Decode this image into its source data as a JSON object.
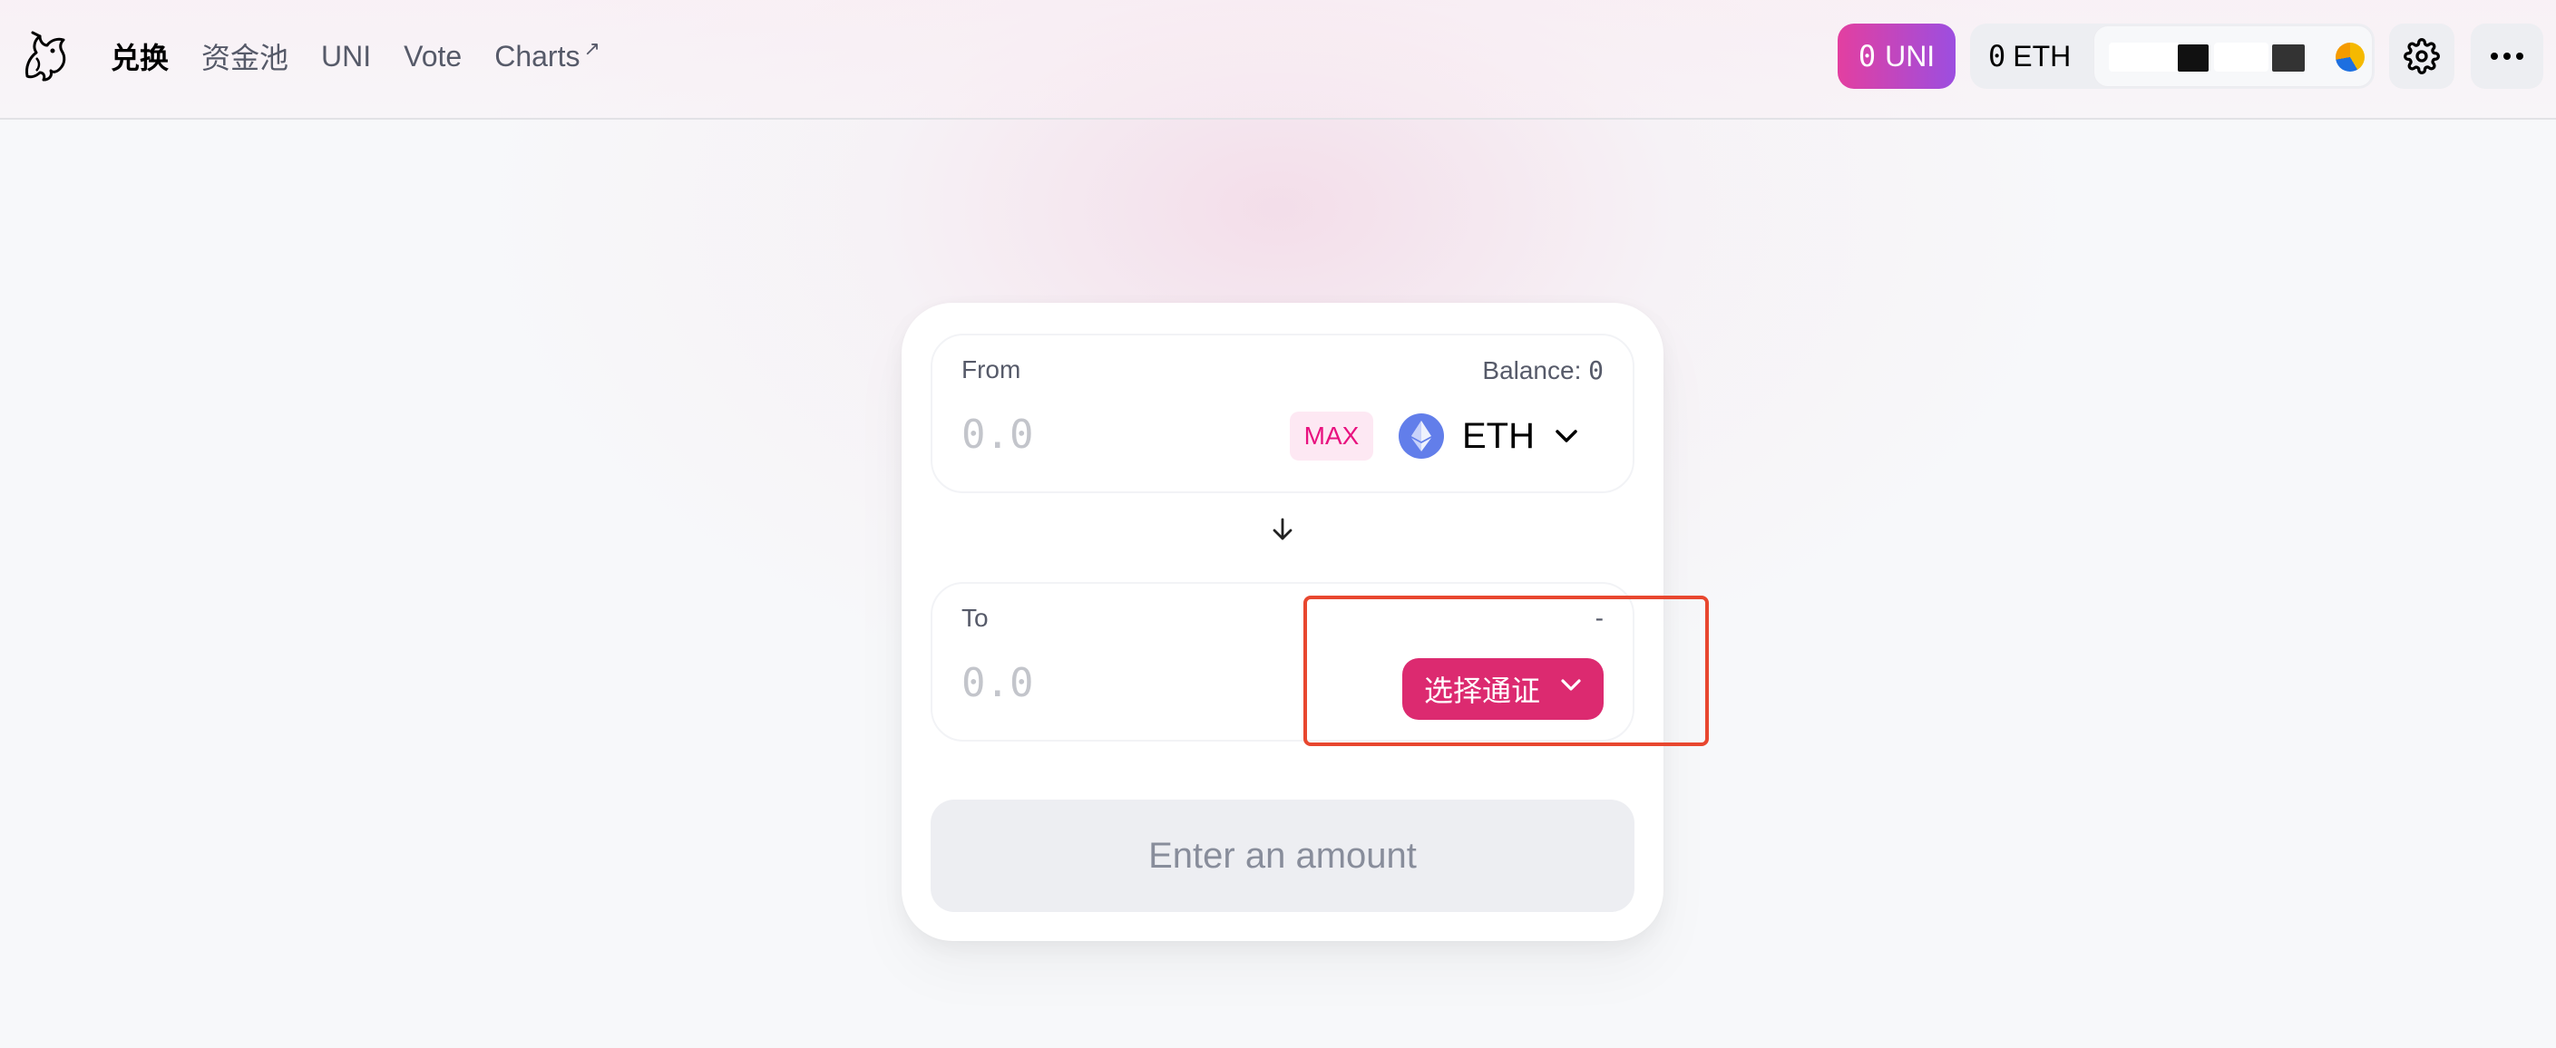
{
  "header": {
    "logo_icon": "unicorn-logo-icon",
    "nav": [
      {
        "label": "兑换",
        "active": true
      },
      {
        "label": "资金池",
        "active": false
      },
      {
        "label": "UNI",
        "active": false
      },
      {
        "label": "Vote",
        "active": false
      },
      {
        "label": "Charts",
        "suffix": "↗",
        "active": false
      }
    ],
    "uni_balance": {
      "amount": "0",
      "symbol": "UNI"
    },
    "eth_balance": {
      "amount": "0",
      "symbol": "ETH"
    },
    "settings_icon": "gear-icon",
    "more_icon": "more-dots-icon"
  },
  "swap": {
    "from": {
      "label": "From",
      "balance_label": "Balance:",
      "balance_value": "0",
      "amount_placeholder": "0.0",
      "max_label": "MAX",
      "token_symbol": "ETH",
      "token_icon": "ethereum-icon"
    },
    "switch_icon": "arrow-down-icon",
    "to": {
      "label": "To",
      "right_text": "-",
      "amount_placeholder": "0.0",
      "select_token_label": "选择通证"
    },
    "submit_label": "Enter an amount"
  },
  "colors": {
    "accent_pink": "#dc2a70",
    "uni_gradient_start": "#e33fa0",
    "uni_gradient_end": "#9c4ee0",
    "highlight_box": "#e8472f"
  }
}
